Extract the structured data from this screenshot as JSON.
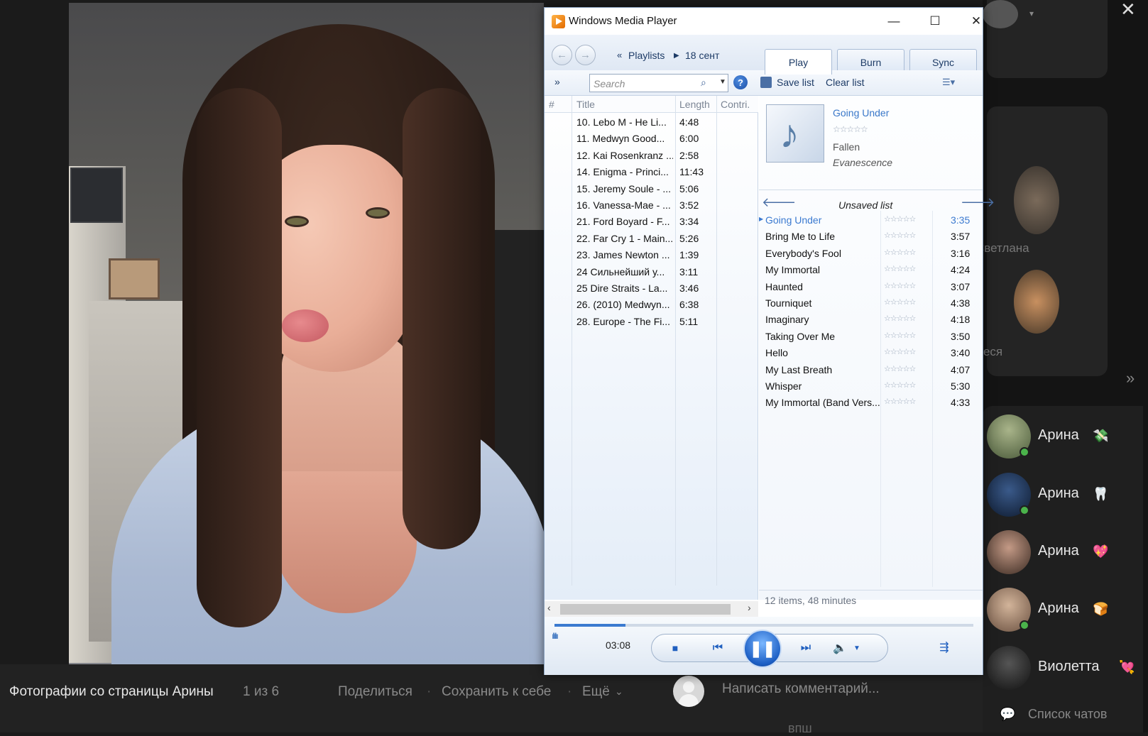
{
  "photo_viewer": {
    "caption": "Фотографии со страницы Арины",
    "counter": "1 из 6",
    "share_label": "Поделиться",
    "save_label": "Сохранить к себе",
    "more_label": "Ещё",
    "comment_placeholder": "Написать комментарий..."
  },
  "wmp": {
    "title": "Windows Media Player",
    "breadcrumb": [
      "Playlists",
      "18 сент"
    ],
    "tabs": [
      "Play",
      "Burn",
      "Sync"
    ],
    "search_placeholder": "Search",
    "save_list": "Save list",
    "clear_list": "Clear list",
    "library_columns": [
      "#",
      "Title",
      "Length",
      "Contri."
    ],
    "library": [
      {
        "title": "10. Lebo M - He Li...",
        "length": "4:48"
      },
      {
        "title": "11. Medwyn Good...",
        "length": "6:00"
      },
      {
        "title": "12. Kai Rosenkranz ...",
        "length": "2:58"
      },
      {
        "title": "14. Enigma - Princi...",
        "length": "11:43"
      },
      {
        "title": "15. Jeremy Soule - ...",
        "length": "5:06"
      },
      {
        "title": "16. Vanessa-Mae - ...",
        "length": "3:52"
      },
      {
        "title": "21. Ford Boyard - F...",
        "length": "3:34"
      },
      {
        "title": "22. Far Cry 1 - Main...",
        "length": "5:26"
      },
      {
        "title": "23. James Newton ...",
        "length": "1:39"
      },
      {
        "title": "24 Сильнейший у...",
        "length": "3:11"
      },
      {
        "title": "25 Dire Straits - La...",
        "length": "3:46"
      },
      {
        "title": "26. (2010) Medwyn...",
        "length": "6:38"
      },
      {
        "title": "28. Europe - The Fi...",
        "length": "5:11"
      }
    ],
    "now_playing": {
      "song": "Going Under",
      "album": "Fallen",
      "artist": "Evanescence"
    },
    "list_title": "Unsaved list",
    "playlist": [
      {
        "title": "Going Under",
        "length": "3:35",
        "current": true
      },
      {
        "title": "Bring Me to Life",
        "length": "3:57"
      },
      {
        "title": "Everybody's Fool",
        "length": "3:16"
      },
      {
        "title": "My Immortal",
        "length": "4:24"
      },
      {
        "title": "Haunted",
        "length": "3:07"
      },
      {
        "title": "Tourniquet",
        "length": "4:38"
      },
      {
        "title": "Imaginary",
        "length": "4:18"
      },
      {
        "title": "Taking Over Me",
        "length": "3:50"
      },
      {
        "title": "Hello",
        "length": "3:40"
      },
      {
        "title": "My Last Breath",
        "length": "4:07"
      },
      {
        "title": "Whisper",
        "length": "5:30"
      },
      {
        "title": "My Immortal (Band Vers...",
        "length": "4:33"
      }
    ],
    "footer": "12 items, 48 minutes",
    "elapsed": "03:08",
    "progress": 0.17,
    "accent": "#3b7ad0"
  },
  "chats": {
    "items": [
      {
        "name": "Арина",
        "emoji": "💸"
      },
      {
        "name": "Арина",
        "emoji": "🦷"
      },
      {
        "name": "Арина",
        "emoji": "💖"
      },
      {
        "name": "Арина",
        "emoji": "🍞"
      },
      {
        "name": "Виолетта",
        "emoji": "💘"
      }
    ],
    "list_label": "Список чатов",
    "friends": [
      "Светлана",
      "Олеся"
    ],
    "partial_label": "впш"
  }
}
